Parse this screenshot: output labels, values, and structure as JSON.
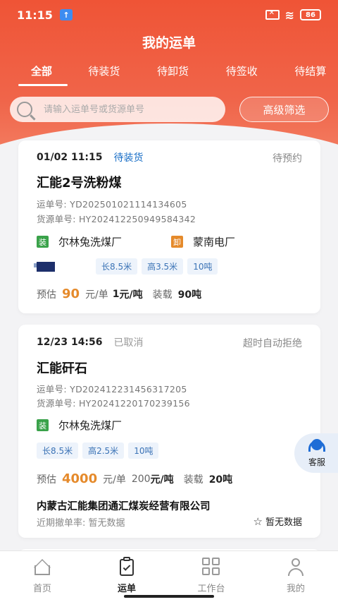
{
  "status_bar": {
    "time": "11:15",
    "battery": "86"
  },
  "header": {
    "title": "我的运单"
  },
  "tabs": [
    {
      "label": "全部",
      "active": true
    },
    {
      "label": "待装货"
    },
    {
      "label": "待卸货"
    },
    {
      "label": "待签收"
    },
    {
      "label": "待结算"
    }
  ],
  "search": {
    "placeholder": "请输入运单号或货源单号"
  },
  "filter_button": "高级筛选",
  "orders": [
    {
      "datetime": "01/02 11:15",
      "status": "待装货",
      "corner_status": "待预约",
      "cargo": "汇能2号洗粉煤",
      "waybill": "运单号:  YD202501021114134605",
      "source": "货源单号:  HY20241225094958434​2",
      "load_tag": "装",
      "load_place": "尔林兔洗煤厂",
      "unload_tag": "卸",
      "unload_place": "蒙南电厂",
      "chips": [
        "长8.5米",
        "高3.5米",
        "10吨"
      ],
      "price_label": "预估",
      "price": "90",
      "price_unit": "元/单",
      "unit_price": "1",
      "unit_price_unit": "元/吨",
      "load_label": "装载",
      "load_weight": "90吨"
    },
    {
      "datetime": "12/23 14:56",
      "status": "已取消",
      "corner_status": "超时自动拒绝",
      "cargo": "汇能矸石",
      "waybill": "运单号:  YD202412231456317205",
      "source": "货源单号:  HY20241220170239156",
      "load_tag": "装",
      "load_place": "尔林兔洗煤厂",
      "chips": [
        "长8.5米",
        "高2.5米",
        "10吨"
      ],
      "price_label": "预估",
      "price": "4000",
      "price_unit": "元/单",
      "unit_price": "200",
      "unit_price_unit": "元/吨",
      "load_label": "装载",
      "load_weight": "20吨",
      "company": "内蒙古汇能集团通汇煤炭经营有限公司",
      "cancel_rate": "近期撤单率:  暂无数据",
      "rating": "暂无数据"
    }
  ],
  "service": {
    "label": "客服"
  },
  "bottom_nav": [
    {
      "label": "首页",
      "icon": "home-icon"
    },
    {
      "label": "运单",
      "icon": "clipboard-icon",
      "active": true
    },
    {
      "label": "工作台",
      "icon": "grid-icon"
    },
    {
      "label": "我的",
      "icon": "user-icon"
    }
  ]
}
